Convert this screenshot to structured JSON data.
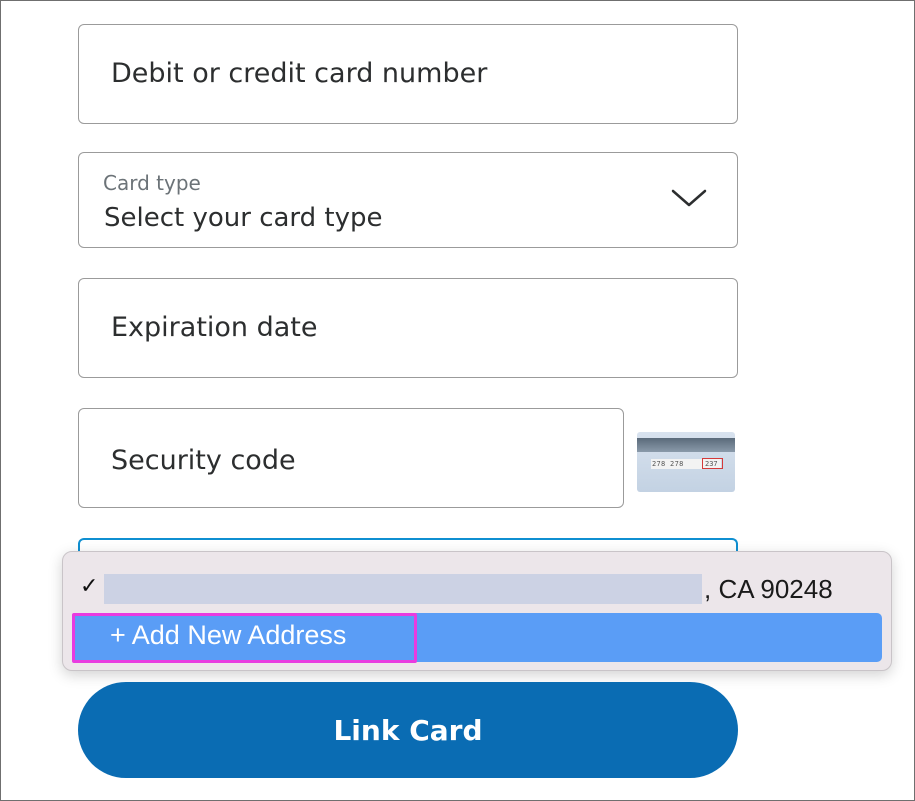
{
  "form": {
    "card_number_placeholder": "Debit or credit card number",
    "card_type_label": "Card type",
    "card_type_value": "Select your card type",
    "expiration_placeholder": "Expiration date",
    "security_code_placeholder": "Security code",
    "card_image": {
      "numbers": "278 278",
      "cvv": "237"
    }
  },
  "address_dropdown": {
    "selected_option": {
      "check": "✓",
      "suffix": ", CA 90248"
    },
    "add_option": "+ Add New Address"
  },
  "submit_label": "Link Card",
  "colors": {
    "primary_button": "#0a6cb3",
    "focus_border": "#0f8fd1",
    "option_highlight": "#5a9df6",
    "annotation": "#e93be0"
  }
}
